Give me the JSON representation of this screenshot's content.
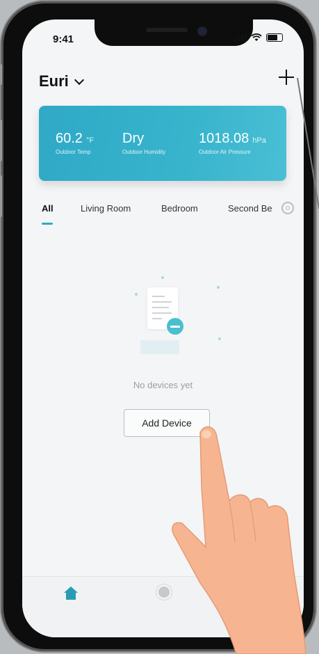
{
  "status_bar": {
    "time": "9:41"
  },
  "header": {
    "home_name": "Euri"
  },
  "weather": {
    "temp": {
      "value": "60.2",
      "unit": "°F",
      "label": "Outdoor Temp"
    },
    "humidity": {
      "value": "Dry",
      "label": "Outdoor Humidity"
    },
    "pressure": {
      "value": "1018.08",
      "unit": "hPa",
      "label": "Outdoor Air Pressure"
    }
  },
  "tabs": [
    {
      "label": "All",
      "active": true
    },
    {
      "label": "Living Room"
    },
    {
      "label": "Bedroom"
    },
    {
      "label": "Second Be"
    }
  ],
  "empty_state": {
    "message": "No devices yet",
    "button": "Add Device"
  },
  "colors": {
    "accent": "#2fa9c6",
    "card_gradient_end": "#4abfd4"
  },
  "icons": [
    "plus-icon",
    "chevron-down-icon",
    "settings-icon",
    "home-icon",
    "scene-icon"
  ]
}
